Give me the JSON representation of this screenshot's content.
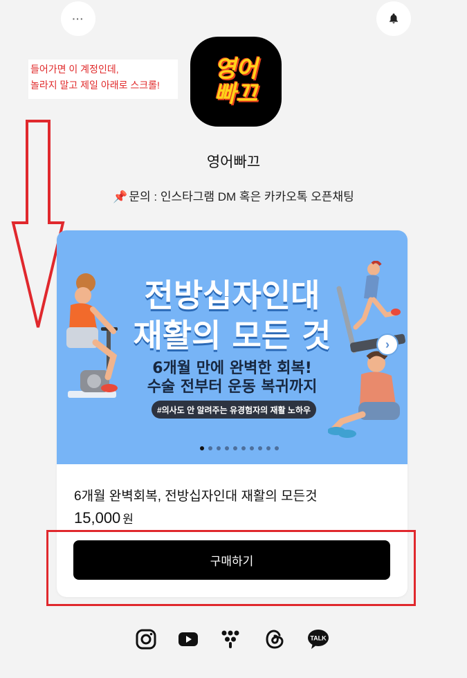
{
  "header": {
    "more_label": "···"
  },
  "profile": {
    "logo_line1": "영어",
    "logo_line2": "빠끄",
    "name": "영어빠끄",
    "contact": "문의 : 인스타그램 DM 혹은 카카오톡 오픈채팅",
    "contact_icon": "pin-icon"
  },
  "annotation": {
    "line1": "들어가면 이 계정인데,",
    "line2": "놀라지 말고 제일 아래로 스크롤!"
  },
  "product": {
    "banner_title_1": "전방십자인대",
    "banner_title_2": "재활의 모든 것",
    "banner_sub_1": "6개월 만에 완벽한 회복!",
    "banner_sub_2": "수술 전부터 운동 복귀까지",
    "banner_tag": "#의사도 안 알려주는 유경험자의 재활 노하우",
    "slide_count": 10,
    "active_slide": 1,
    "title": "6개월 완벽회복, 전방십자인대 재활의 모든것",
    "price": "15,000",
    "currency": "원",
    "buy_label": "구매하기"
  },
  "socials": [
    "instagram-icon",
    "youtube-icon",
    "linktree-icon",
    "threads-icon",
    "kakaotalk-icon"
  ],
  "colors": {
    "annotation_red": "#e0292a",
    "banner_blue": "#77b4f6",
    "logo_yellow": "#ffd21a",
    "button_black": "#000000"
  }
}
